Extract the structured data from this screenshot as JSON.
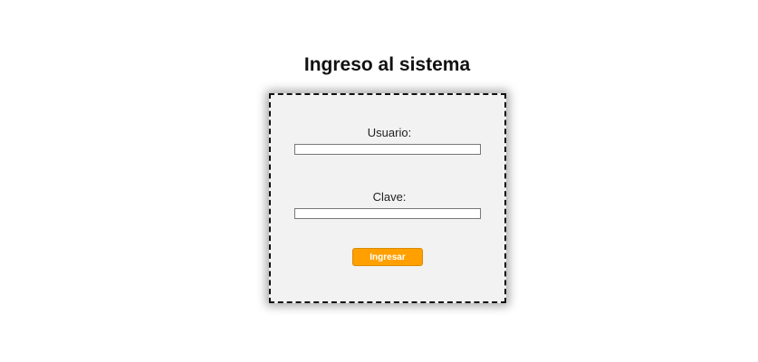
{
  "page": {
    "title": "Ingreso al sistema"
  },
  "login_form": {
    "username_label": "Usuario:",
    "username_value": "",
    "password_label": "Clave:",
    "password_value": "",
    "submit_label": "Ingresar"
  },
  "colors": {
    "accent": "#ffa000",
    "panel_background": "#f2f2f2"
  }
}
